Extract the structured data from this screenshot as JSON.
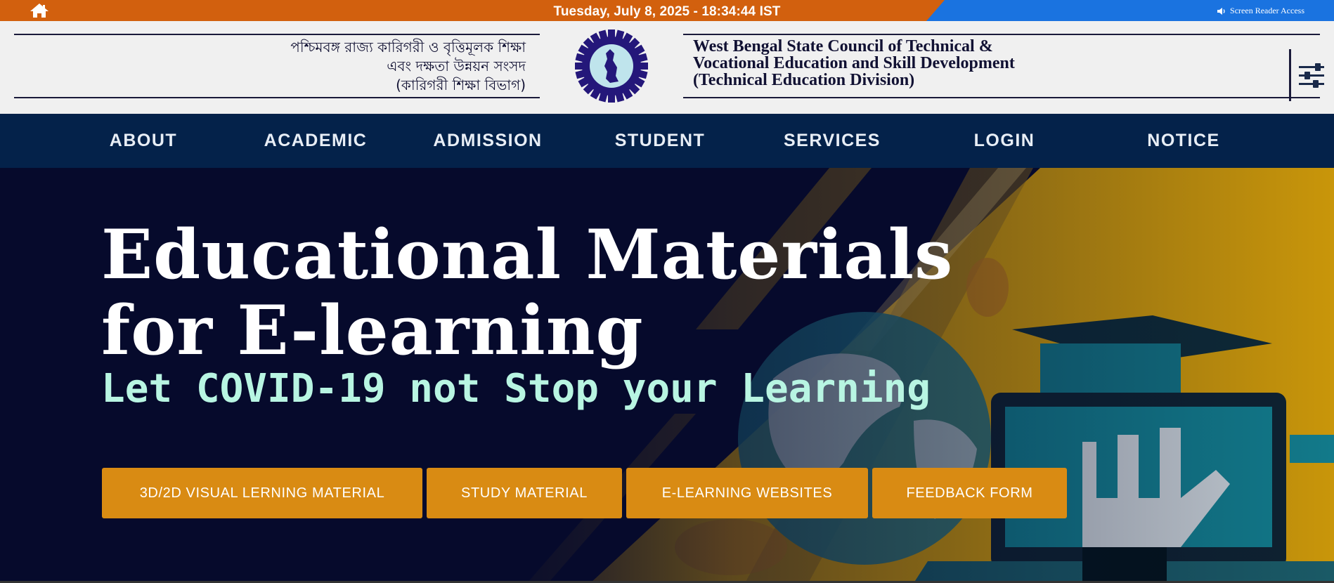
{
  "topbar": {
    "datetime": "Tuesday, July 8, 2025 - 18:34:44 IST",
    "screen_reader_label": "Screen Reader Access",
    "home_icon": "home-icon",
    "speaker_icon": "speaker-icon",
    "colors": {
      "orange": "#d2600e",
      "blue": "#1a73e0"
    }
  },
  "header": {
    "bengali_lines": [
      "পশ্চিমবঙ্গ রাজ্য কারিগরী ও বৃত্তিমূলক শিক্ষা",
      "এবং দক্ষতা উন্নয়ন সংসদ",
      "(কারিগরী শিক্ষা বিভাগ)"
    ],
    "english_lines": [
      "West Bengal State Council of Technical &",
      "Vocational Education and Skill Development",
      "(Technical Education Division)"
    ],
    "logo_icon": "council-seal-logo",
    "settings_icon": "sliders-icon"
  },
  "nav": {
    "items": [
      {
        "label": "ABOUT"
      },
      {
        "label": "ACADEMIC"
      },
      {
        "label": "ADMISSION"
      },
      {
        "label": "STUDENT"
      },
      {
        "label": "SERVICES"
      },
      {
        "label": "LOGIN"
      },
      {
        "label": "NOTICE"
      }
    ],
    "background": "#04224a"
  },
  "hero": {
    "title": "Educational Materials for E-learning",
    "subtitle": "Let COVID-19 not Stop your Learning",
    "buttons": [
      {
        "label": "3D/2D VISUAL LERNING MATERIAL"
      },
      {
        "label": "STUDY MATERIAL"
      },
      {
        "label": "E-LEARNING WEBSITES"
      },
      {
        "label": "FEEDBACK FORM"
      }
    ],
    "colors": {
      "background": "#060a2c",
      "accent": "#d98b13",
      "subtitle": "#b8f5e2",
      "art_yellow": "#c9960a"
    }
  }
}
